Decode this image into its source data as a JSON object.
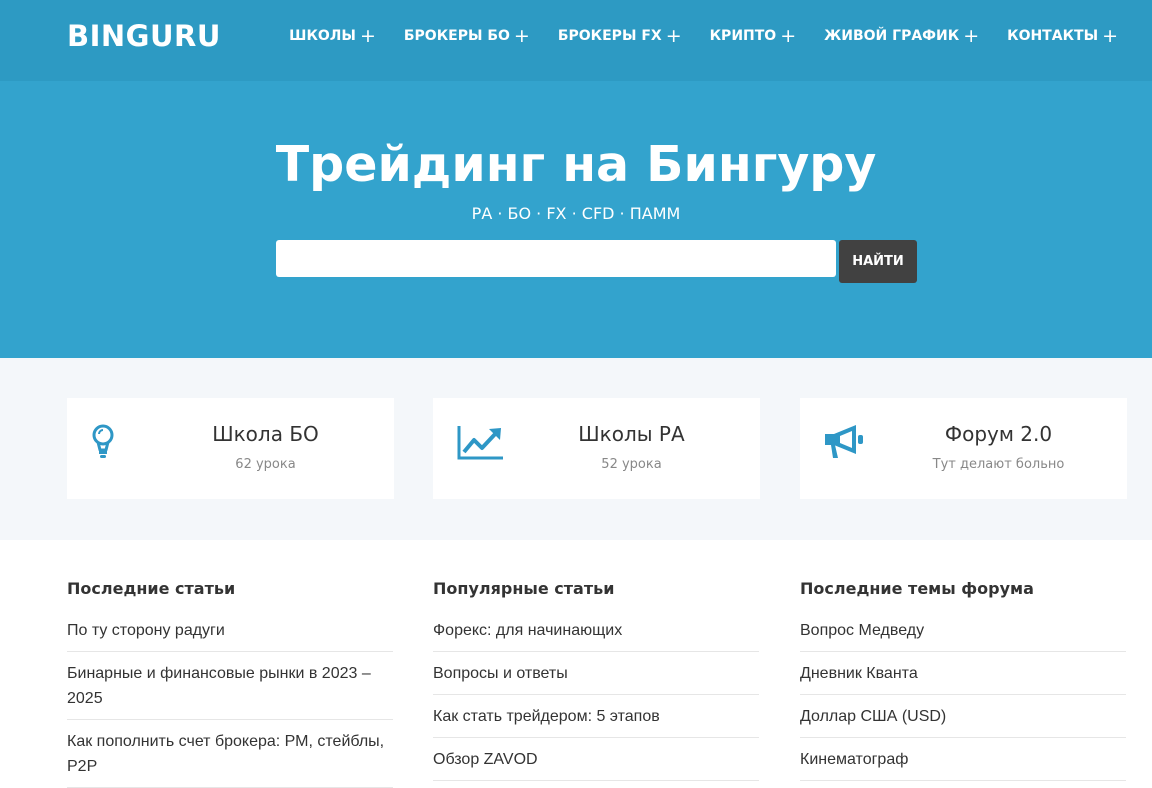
{
  "header": {
    "logo": "BINGURU",
    "nav": [
      {
        "label": "ШКОЛЫ",
        "plus": "+"
      },
      {
        "label": "БРОКЕРЫ БО",
        "plus": "+"
      },
      {
        "label": "БРОКЕРЫ FX",
        "plus": "+"
      },
      {
        "label": "КРИПТО",
        "plus": "+"
      },
      {
        "label": "ЖИВОЙ ГРАФИК",
        "plus": "+"
      },
      {
        "label": "КОНТАКТЫ",
        "plus": "+"
      }
    ]
  },
  "hero": {
    "title": "Трейдинг на Бингуру",
    "subtitle": "РА · БО · FX · CFD · ПАММ",
    "search_placeholder": "",
    "search_button": "НАЙТИ"
  },
  "features": [
    {
      "icon": "lightbulb-icon",
      "title": "Школа БО",
      "desc": "62 урока"
    },
    {
      "icon": "chart-up-icon",
      "title": "Школы РА",
      "desc": "52 урока"
    },
    {
      "icon": "megaphone-icon",
      "title": "Форум 2.0",
      "desc": "Тут делают больно"
    }
  ],
  "columns": [
    {
      "title": "Последние статьи",
      "items": [
        "По ту сторону радуги",
        "Бинарные и финансовые рынки в 2023 – 2025",
        "Как пополнить счет брокера: РМ, стейблы, P2P"
      ]
    },
    {
      "title": "Популярные статьи",
      "items": [
        "Форекс: для начинающих",
        "Вопросы и ответы",
        "Как стать трейдером: 5 этапов",
        "Обзор ZAVOD"
      ]
    },
    {
      "title": "Последние темы форума",
      "items": [
        "Вопрос Медведу",
        "Дневник Кванта",
        "Доллар США (USD)",
        "Кинематограф"
      ]
    }
  ],
  "colors": {
    "topbar": "#2d9ac3",
    "hero": "#33a3cd",
    "accent_icon": "#2e97c6",
    "button": "#414141"
  }
}
